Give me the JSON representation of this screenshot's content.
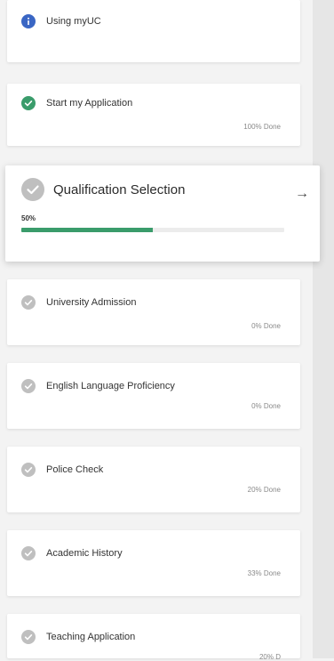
{
  "colors": {
    "info": "#3a66c4",
    "complete": "#3a9c6b",
    "pending": "#bfbfbf",
    "progress_fill": "#3a9c6b"
  },
  "steps": [
    {
      "label": "Using myUC",
      "done_text": "",
      "status": "info",
      "icon": "info-icon"
    },
    {
      "label": "Start my Application",
      "done_text": "100% Done",
      "status": "complete",
      "icon": "check-circle-icon"
    },
    {
      "label": "Qualification Selection",
      "percent_text": "50%",
      "progress": 0.5,
      "status": "active",
      "icon": "check-circle-icon",
      "arrow": "→"
    },
    {
      "label": "University Admission",
      "done_text": "0% Done",
      "status": "pending",
      "icon": "check-circle-icon"
    },
    {
      "label": "English Language Proficiency",
      "done_text": "0% Done",
      "status": "pending",
      "icon": "check-circle-icon"
    },
    {
      "label": "Police Check",
      "done_text": "20% Done",
      "status": "pending",
      "icon": "check-circle-icon"
    },
    {
      "label": "Academic History",
      "done_text": "33% Done",
      "status": "pending",
      "icon": "check-circle-icon"
    },
    {
      "label": "Teaching Application",
      "done_text": "20% D",
      "status": "pending",
      "icon": "check-circle-icon"
    }
  ]
}
